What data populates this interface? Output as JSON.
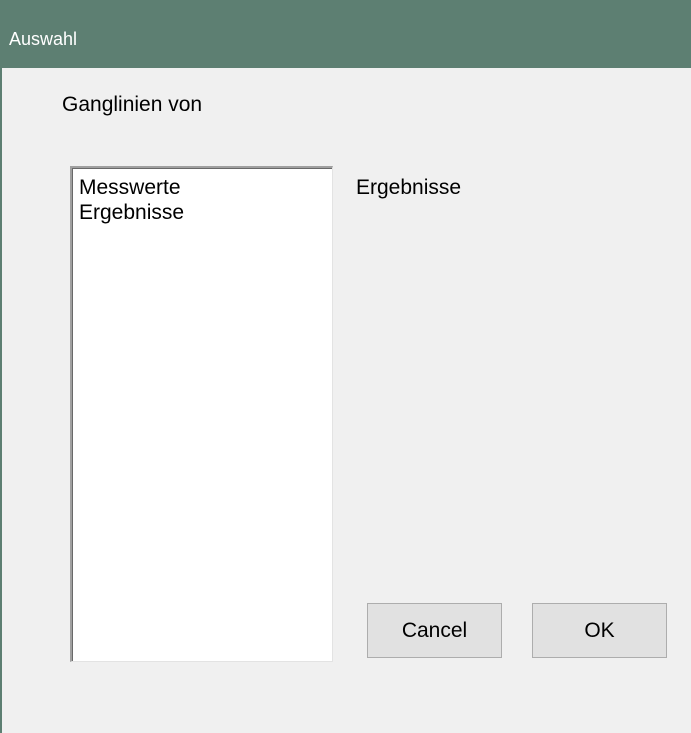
{
  "window": {
    "title": "Auswahl"
  },
  "group": {
    "label": "Ganglinien von"
  },
  "listbox": {
    "items": [
      "Messwerte",
      "Ergebnisse"
    ]
  },
  "selection": {
    "value": "Ergebnisse"
  },
  "buttons": {
    "cancel_label": "Cancel",
    "ok_label": "OK"
  },
  "colors": {
    "titlebar": "#5d7f72",
    "dialog_background": "#f0f0f0"
  }
}
